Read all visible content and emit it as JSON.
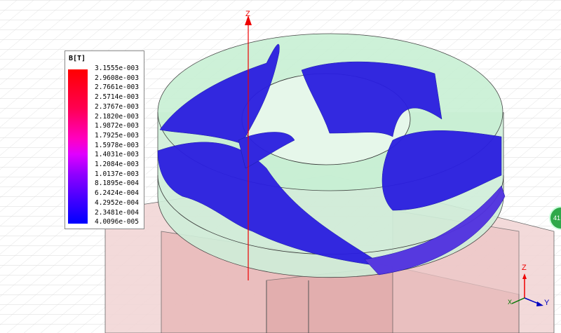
{
  "legend": {
    "title": "B[T]",
    "values": [
      "3.1555e-003",
      "2.9608e-003",
      "2.7661e-003",
      "2.5714e-003",
      "2.3767e-003",
      "2.1820e-003",
      "1.9872e-003",
      "1.7925e-003",
      "1.5978e-003",
      "1.4031e-003",
      "1.2084e-003",
      "1.0137e-003",
      "8.1895e-004",
      "6.2424e-004",
      "4.2952e-004",
      "2.3481e-004",
      "4.0096e-005"
    ],
    "color_max": "#ff0000",
    "color_min": "#0000ff"
  },
  "axes": {
    "z": "Z",
    "y": "Y",
    "x": "X",
    "main_z": "Z"
  },
  "nav": {
    "label": "41"
  }
}
